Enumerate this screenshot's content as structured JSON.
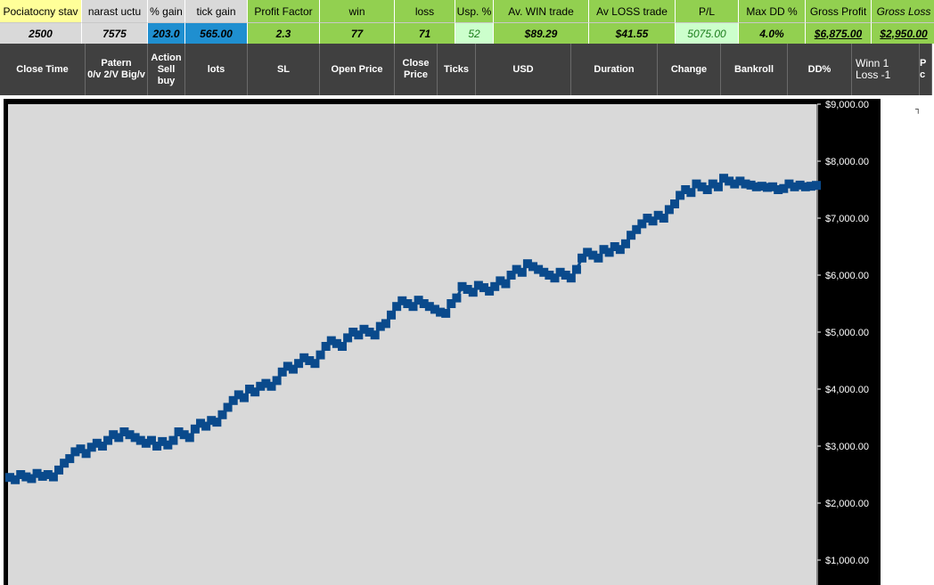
{
  "header_labels": [
    "Pociatocny stav",
    "narast uctu",
    "% gain",
    "tick gain",
    "Profit Factor",
    "win",
    "loss",
    "Usp. %",
    "Av. WIN trade",
    "Av LOSS trade",
    "P/L",
    "Max DD %",
    "Gross Profit",
    "Gross Loss"
  ],
  "header_values": [
    "2500",
    "7575",
    "203.0",
    "565.00",
    "2.3",
    "77",
    "71",
    "52",
    "$89.29",
    "$41.55",
    "5075.00",
    "4.0%",
    "$6,875.00",
    "$2,950.00"
  ],
  "columns": [
    {
      "lines": [
        "Close Time"
      ]
    },
    {
      "lines": [
        "Patern",
        "0/v 2/V Big/v"
      ]
    },
    {
      "lines": [
        "Action",
        "Sell",
        "buy"
      ]
    },
    {
      "lines": [
        "lots"
      ]
    },
    {
      "lines": [
        "SL"
      ]
    },
    {
      "lines": [
        "Open Price"
      ]
    },
    {
      "lines": [
        "Close",
        "Price"
      ]
    },
    {
      "lines": [
        "Ticks"
      ]
    },
    {
      "lines": [
        "USD"
      ]
    },
    {
      "lines": [
        "Duration"
      ]
    },
    {
      "lines": [
        "Change"
      ]
    },
    {
      "lines": [
        "Bankroll"
      ]
    },
    {
      "lines": [
        "DD%"
      ]
    },
    {
      "lines": [
        "Winn  1",
        "Loss -1"
      ]
    },
    {
      "lines": [
        "P",
        "c"
      ]
    }
  ],
  "colors": {
    "label_yellow": "#ffff99",
    "label_grey": "#d9d9d9",
    "label_green": "#92d050",
    "value_blue": "#1f8fd0",
    "value_green": "#92d050",
    "value_lightgreen": "#ccffcc",
    "chart_bg": "#d9d9d9",
    "series": "#0a4a8c"
  },
  "chart_data": {
    "type": "line",
    "title": "",
    "xlabel": "",
    "ylabel": "",
    "ylim": [
      0,
      9000
    ],
    "yticks": [
      1000,
      2000,
      3000,
      4000,
      5000,
      6000,
      7000,
      8000,
      9000
    ],
    "ytick_labels": [
      "$1,000.00",
      "$2,000.00",
      "$3,000.00",
      "$4,000.00",
      "$5,000.00",
      "$6,000.00",
      "$7,000.00",
      "$8,000.00",
      "$9,000.00"
    ],
    "grid": false,
    "legend": "none",
    "series": [
      {
        "values": [
          2450,
          2410,
          2500,
          2460,
          2430,
          2520,
          2470,
          2500,
          2460,
          2580,
          2700,
          2780,
          2900,
          2950,
          2870,
          2980,
          3050,
          3000,
          3100,
          3200,
          3150,
          3250,
          3200,
          3150,
          3100,
          3050,
          3100,
          3000,
          3080,
          3020,
          3100,
          3250,
          3200,
          3150,
          3300,
          3400,
          3350,
          3450,
          3420,
          3550,
          3680,
          3800,
          3900,
          3850,
          4000,
          3950,
          4050,
          4100,
          4050,
          4150,
          4300,
          4400,
          4350,
          4450,
          4550,
          4500,
          4450,
          4600,
          4750,
          4850,
          4800,
          4750,
          4900,
          5000,
          4950,
          5050,
          5000,
          4950,
          5100,
          5150,
          5300,
          5450,
          5550,
          5500,
          5450,
          5560,
          5500,
          5450,
          5400,
          5350,
          5330,
          5500,
          5600,
          5800,
          5750,
          5700,
          5820,
          5780,
          5720,
          5800,
          5900,
          5850,
          6000,
          6100,
          6050,
          6200,
          6150,
          6100,
          6050,
          6000,
          5950,
          6050,
          6000,
          5950,
          6100,
          6300,
          6400,
          6350,
          6300,
          6450,
          6400,
          6500,
          6450,
          6550,
          6700,
          6800,
          6900,
          7000,
          6950,
          7050,
          7000,
          7150,
          7250,
          7400,
          7500,
          7450,
          7600,
          7550,
          7500,
          7600,
          7550,
          7700,
          7650,
          7600,
          7650,
          7600,
          7580,
          7550,
          7560,
          7540,
          7550,
          7500,
          7520,
          7600,
          7550,
          7580,
          7550,
          7560,
          7575
        ]
      }
    ]
  }
}
